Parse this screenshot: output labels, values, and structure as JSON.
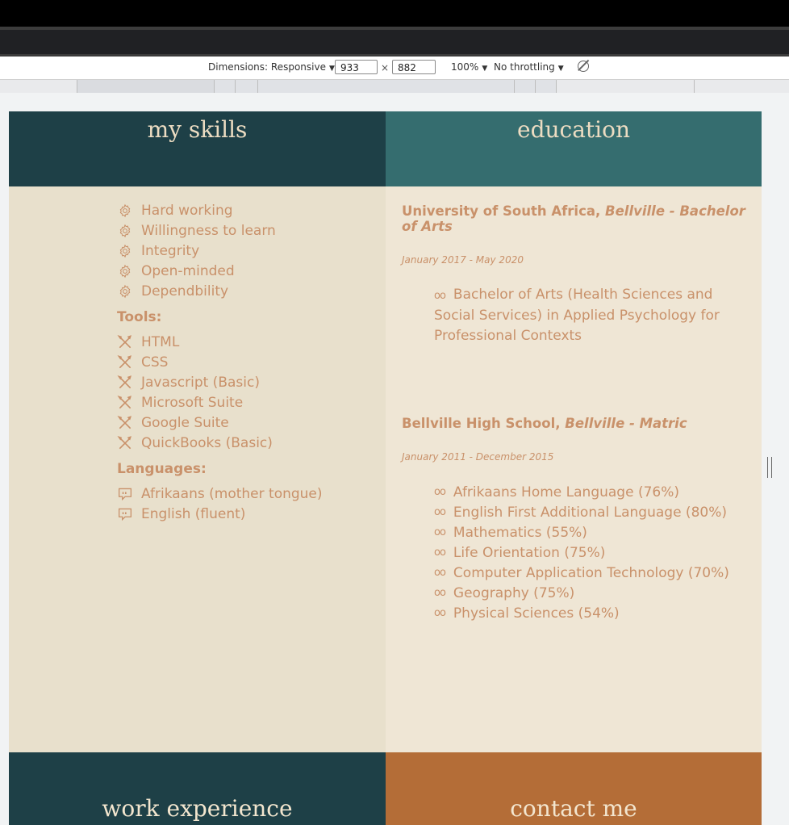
{
  "devtools": {
    "dimensions_label": "Dimensions: Responsive",
    "width_value": "933",
    "height_value": "882",
    "times": "×",
    "zoom": "100%",
    "throttling": "No throttling"
  },
  "skills": {
    "heading": "my skills",
    "items": [
      "Hard working",
      "Willingness to learn",
      "Integrity",
      "Open-minded",
      "Dependbility"
    ],
    "tools_label": "Tools:",
    "tools": [
      "HTML",
      "CSS",
      "Javascript (Basic)",
      "Microsoft Suite",
      "Google Suite",
      "QuickBooks (Basic)"
    ],
    "languages_label": "Languages:",
    "languages": [
      "Afrikaans (mother tongue)",
      "English (fluent)"
    ]
  },
  "education": {
    "heading": "education",
    "entries": [
      {
        "school": "University of South Africa,",
        "detail": "Bellville -  Bachelor of Arts",
        "dates": "January 2017 -  May 2020",
        "items": [
          "Bachelor of Arts (Health Sciences and Social Services) in Applied  Psychology for Professional Contexts"
        ]
      },
      {
        "school": "Bellville  High School,",
        "detail": "Bellville -  Matric",
        "dates": "January 2011 -  December 2015",
        "items": [
          "Afrikaans  Home  Language (76%)",
          "English  First Additional  Language (80%)",
          "Mathematics (55%)",
          "Life Orientation (75%)",
          "Computer Application Technology (70%)",
          "Geography (75%)",
          "Physical Sciences (54%)"
        ]
      }
    ]
  },
  "footer": {
    "work": "work experience",
    "contact": "contact me"
  },
  "colors": {
    "dark_teal": "#1e4047",
    "teal": "#356d6f",
    "cream_left": "#e8e0cc",
    "cream_right": "#efe6d5",
    "accent_text": "#c9916a",
    "orange": "#b46d37"
  }
}
